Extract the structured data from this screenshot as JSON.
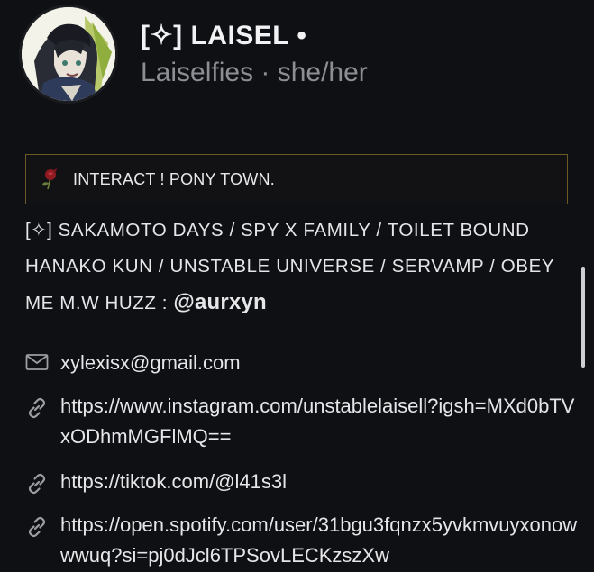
{
  "profile": {
    "name": "[✧] LAISEL •",
    "subtitle": "Laiselfies · she/her"
  },
  "banner": {
    "icon": "rose-icon",
    "text": "INTERACT ! PONY TOWN."
  },
  "bio": {
    "line1": "[✧] SAKAMOTO DAYS / SPY X FAMILY / TOILET BOUND",
    "line2": "HANAKO KUN / UNSTABLE UNIVERSE / SERVAMP / OBEY",
    "line3": "ME M.W HUZZ : ",
    "handle": "@aurxyn"
  },
  "contacts": [
    {
      "icon": "mail-icon",
      "value": "xylexisx@gmail.com"
    },
    {
      "icon": "link-icon",
      "value": "https://www.instagram.com/unstablelaisell?igsh=MXd0bTVxODhmMGFlMQ=="
    },
    {
      "icon": "link-icon",
      "value": "https://tiktok.com/@l41s3l"
    },
    {
      "icon": "link-icon",
      "value": "https://open.spotify.com/user/31bgu3fqnzx5yvkmvuyxonowwwuq?si=pj0dJcl6TPSovLECKzszXw"
    }
  ],
  "colors": {
    "background": "#0f1013",
    "banner_border": "#6b5a24",
    "subtitle": "#8d8e94"
  }
}
